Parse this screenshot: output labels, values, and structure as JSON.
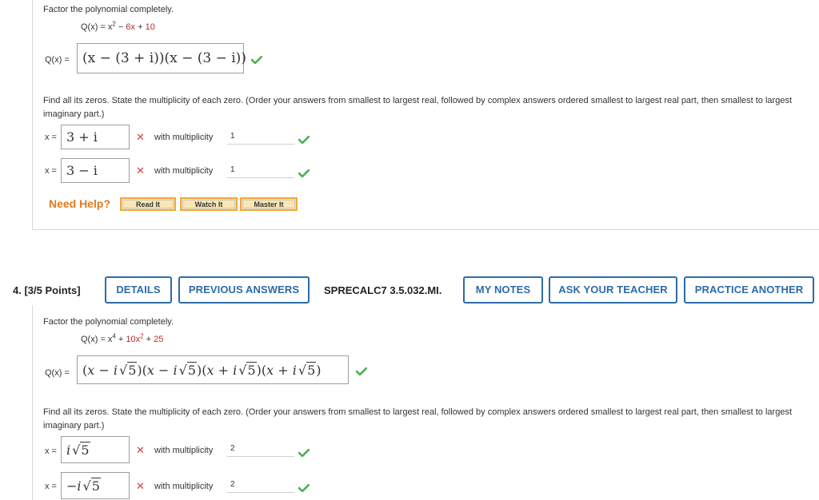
{
  "q3": {
    "prompt": "Factor the polynomial completely.",
    "poly_prefix": "Q(x) = x",
    "poly_exp": "2",
    "poly_mid": " − ",
    "poly_c1": "6x",
    "poly_plus": " + ",
    "poly_c2": "10",
    "q_label": "Q(x) =",
    "factored": "(x − (3 + i))(x − (3 − i))",
    "zeros_instructions": "Find all its zeros. State the multiplicity of each zero. (Order your answers from smallest to largest real, followed by complex answers ordered smallest to largest real part, then smallest to largest imaginary part.)",
    "x_label": "x =",
    "zero1": "3 + i",
    "zero2": "3 − i",
    "with_multiplicity": "with multiplicity",
    "mult1": "1",
    "mult2": "1",
    "need_help": "Need Help?",
    "read_it": "Read It",
    "watch_it": "Watch It",
    "master_it": "Master It"
  },
  "q4": {
    "number": "4.  [3/5 Points]",
    "details": "DETAILS",
    "previous_answers": "PREVIOUS ANSWERS",
    "code": "SPRECALC7 3.5.032.MI.",
    "my_notes": "MY NOTES",
    "ask_teacher": "ASK YOUR TEACHER",
    "practice_another": "PRACTICE ANOTHER",
    "prompt": "Factor the polynomial completely.",
    "poly_prefix": "Q(x) = x",
    "poly_exp1": "4",
    "poly_plus": " + ",
    "poly_c1": "10x",
    "poly_exp2": "2",
    "poly_plus2": " + ",
    "poly_c2": "25",
    "q_label": "Q(x) =",
    "sqrt_arg": "5",
    "zeros_instructions": "Find all its zeros. State the multiplicity of each zero. (Order your answers from smallest to largest real, followed by complex answers ordered smallest to largest real part, then smallest to largest imaginary part.)",
    "x_label": "x =",
    "with_multiplicity": "with multiplicity",
    "mult1": "2",
    "mult2": "2"
  },
  "colors": {
    "accent_blue": "#2d6ba8",
    "check_green": "#4caf50",
    "cross_red": "#d3443a",
    "help_orange": "#e07b1f"
  }
}
